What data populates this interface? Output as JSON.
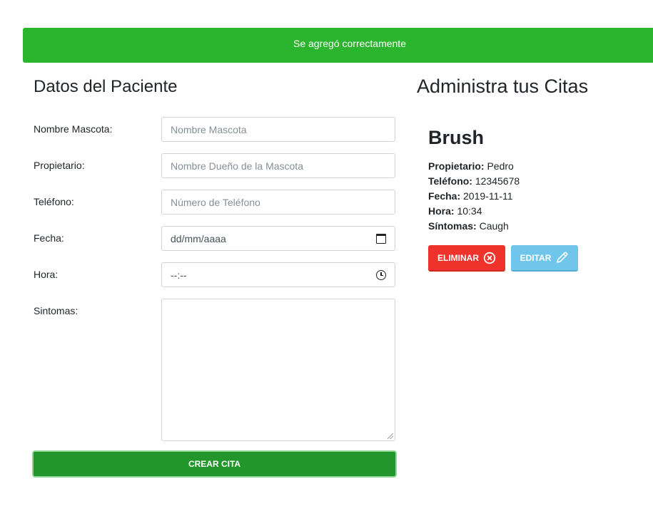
{
  "alert": {
    "message": "Se agregó correctamente",
    "color": "#2bb52f"
  },
  "form": {
    "title": "Datos del Paciente",
    "fields": {
      "mascota": {
        "label": "Nombre Mascota:",
        "placeholder": "Nombre Mascota"
      },
      "propietario": {
        "label": "Propietario:",
        "placeholder": "Nombre Dueño de la Mascota"
      },
      "telefono": {
        "label": "Teléfono:",
        "placeholder": "Número de Teléfono"
      },
      "fecha": {
        "label": "Fecha:",
        "placeholder": "dd/mm/aaaa",
        "icon": "calendar-icon"
      },
      "hora": {
        "label": "Hora:",
        "placeholder": "--:--",
        "icon": "clock-icon"
      },
      "sintomas": {
        "label": "Sintomas:",
        "value": ""
      }
    },
    "submit_label": "CREAR CITA"
  },
  "citas": {
    "title": "Administra tus Citas",
    "items": [
      {
        "name": "Brush",
        "propietario_label": "Propietario:",
        "propietario": "Pedro",
        "telefono_label": "Teléfono:",
        "telefono": "12345678",
        "fecha_label": "Fecha:",
        "fecha": "2019-11-11",
        "hora_label": "Hora:",
        "hora": "10:34",
        "sintomas_label": "Síntomas:",
        "sintomas": "Caugh",
        "delete_label": "ELIMINAR",
        "delete_icon": "close-circle-icon",
        "edit_label": "EDITAR",
        "edit_icon": "pencil-icon"
      }
    ]
  },
  "colors": {
    "success": "#2bb52f",
    "submit": "#22962a",
    "danger": "#f0322c",
    "info": "#6fc6ea"
  }
}
